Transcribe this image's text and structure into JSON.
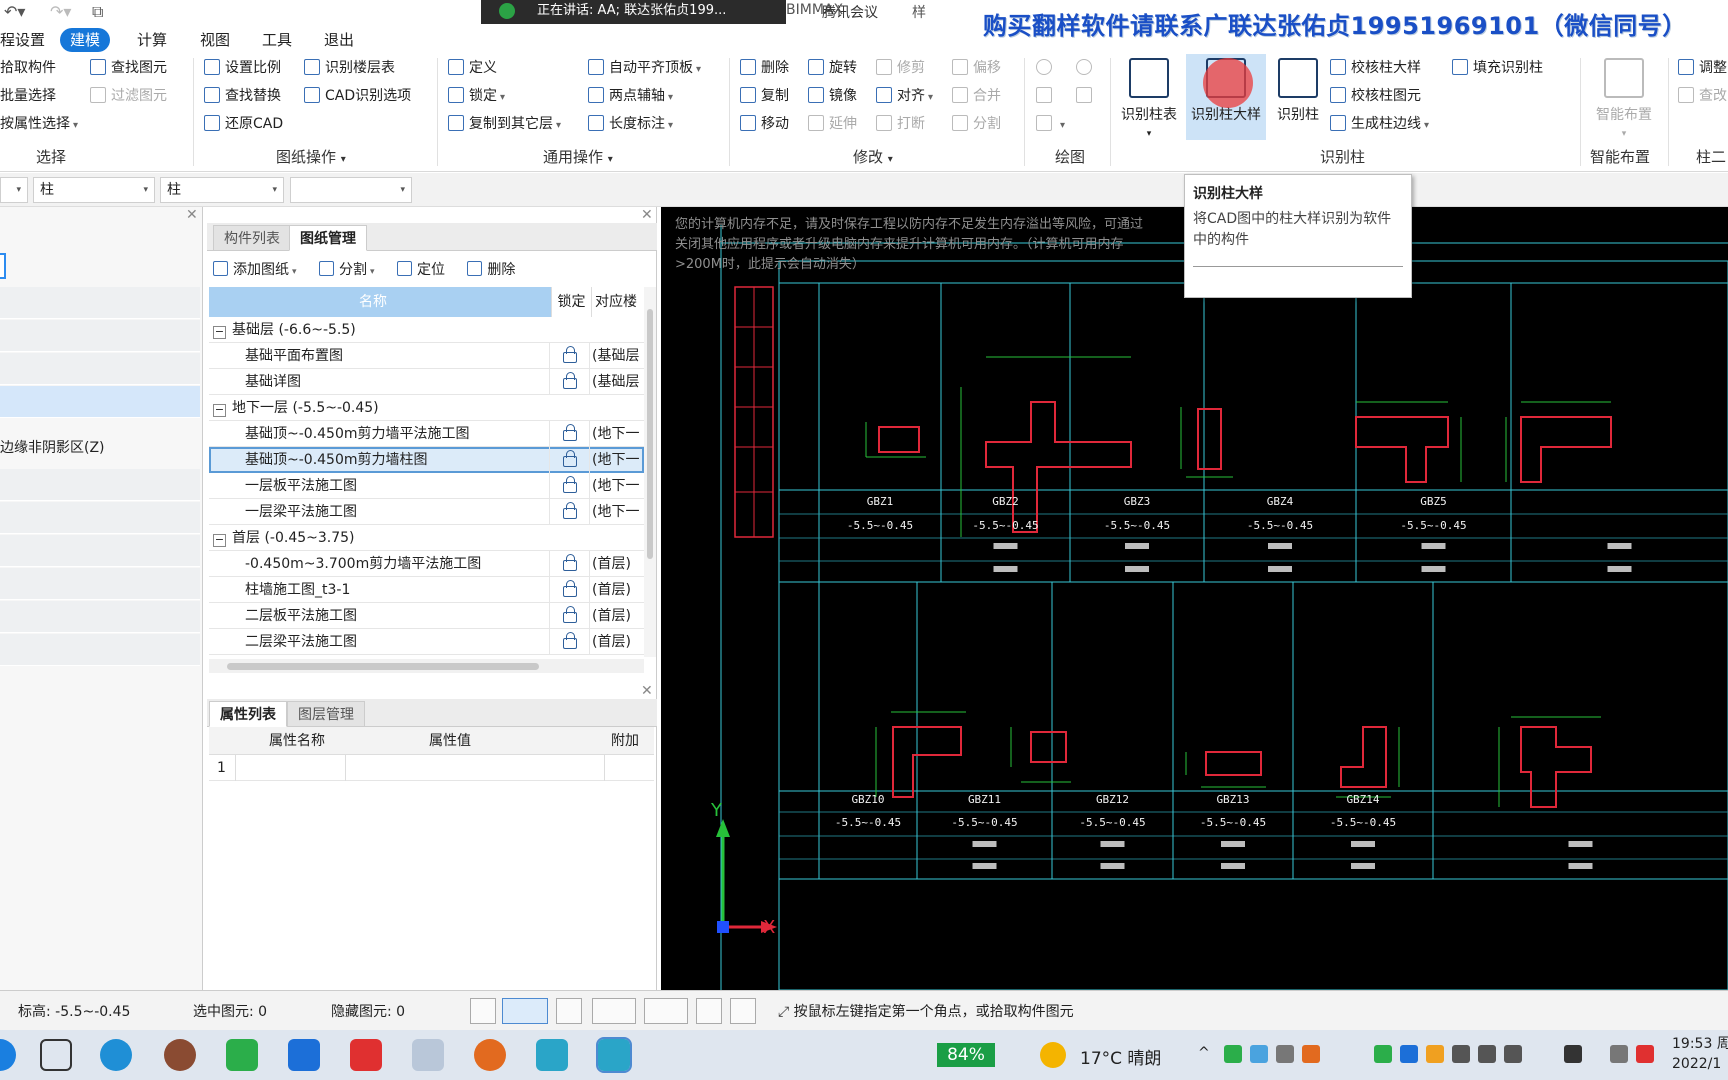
{
  "window": {
    "meeting_banner": "正在讲话: AA; 联达张佑贞199...",
    "meeting_app": "腾讯会议",
    "bimmax": "BIMMAX",
    "title_suffix": "样",
    "ad_text": "购买翻样软件请联系广联达张佑贞19951969101（微信同号）"
  },
  "menu": {
    "items": [
      "程设置",
      "建模",
      "计算",
      "视图",
      "工具",
      "退出"
    ],
    "active": "建模"
  },
  "ribbon": {
    "select_group": {
      "label": "选择",
      "buttons": [
        "拾取构件",
        "查找图元",
        "批量选择",
        "过滤图元",
        "按属性选择"
      ]
    },
    "drawing_ops": {
      "label": "图纸操作",
      "buttons": [
        "设置比例",
        "识别楼层表",
        "查找替换",
        "CAD识别选项",
        "还原CAD"
      ]
    },
    "general_ops": {
      "label": "通用操作",
      "buttons": [
        "定义",
        "自动平齐顶板",
        "锁定",
        "两点辅轴",
        "复制到其它层",
        "长度标注"
      ]
    },
    "modify": {
      "label": "修改",
      "buttons": [
        "删除",
        "旋转",
        "修剪",
        "偏移",
        "复制",
        "镜像",
        "对齐",
        "合并",
        "移动",
        "延伸",
        "打断",
        "分割"
      ]
    },
    "draw": {
      "label": "绘图"
    },
    "recognize_col": {
      "label": "识别柱",
      "big": [
        "识别柱表",
        "识别柱大样",
        "识别柱"
      ],
      "small": [
        "校核柱大样",
        "填充识别柱",
        "校核柱图元",
        "生成柱边线"
      ]
    },
    "smart": {
      "label": "智能布置",
      "big": "智能布置"
    },
    "col_2d": {
      "label": "柱二",
      "small": [
        "调整",
        "查改"
      ]
    }
  },
  "filters": {
    "selects": [
      "",
      "柱",
      "柱",
      ""
    ]
  },
  "left_panel": {
    "item_text": "边缘非阴影区(Z)"
  },
  "mid_panel": {
    "tabs": [
      "构件列表",
      "图纸管理"
    ],
    "active_tab": "图纸管理",
    "toolbar": [
      "添加图纸",
      "分割",
      "定位",
      "删除"
    ],
    "columns": [
      "名称",
      "锁定",
      "对应楼"
    ],
    "rows": [
      {
        "type": "group",
        "name": "基础层 (-6.6~-5.5)"
      },
      {
        "type": "item",
        "name": "基础平面布置图",
        "floor": "(基础层"
      },
      {
        "type": "item",
        "name": "基础详图",
        "floor": "(基础层"
      },
      {
        "type": "group",
        "name": "地下一层 (-5.5~-0.45)"
      },
      {
        "type": "item",
        "name": "基础顶~-0.450m剪力墙平法施工图",
        "floor": "(地下一"
      },
      {
        "type": "item",
        "name": "基础顶~-0.450m剪力墙柱图",
        "floor": "(地下一",
        "selected": true
      },
      {
        "type": "item",
        "name": "一层板平法施工图",
        "floor": "(地下一"
      },
      {
        "type": "item",
        "name": "一层梁平法施工图",
        "floor": "(地下一"
      },
      {
        "type": "group",
        "name": "首层 (-0.45~3.75)"
      },
      {
        "type": "item",
        "name": "-0.450m~3.700m剪力墙平法施工图",
        "floor": "(首层)"
      },
      {
        "type": "item",
        "name": "柱墙施工图_t3-1",
        "floor": "(首层)"
      },
      {
        "type": "item",
        "name": "二层板平法施工图",
        "floor": "(首层)"
      },
      {
        "type": "item",
        "name": "二层梁平法施工图",
        "floor": "(首层)"
      }
    ],
    "prop_tabs": [
      "属性列表",
      "图层管理"
    ],
    "prop_active": "属性列表",
    "prop_columns": [
      "属性名称",
      "属性值",
      "附加"
    ],
    "prop_row_num": "1"
  },
  "cad": {
    "memory_msg": "您的计算机内存不足，请及时保存工程以防内存不足发生内存溢出等风险，可通过关闭其他应用程序或者升级电脑内存来提升计算机可用内存。（计算机可用内存>200M时，此提示会自动消失）",
    "row1_labels": [
      "GBZ1",
      "GBZ2",
      "GBZ3",
      "GBZ4",
      "GBZ5"
    ],
    "row2_labels": [
      "GBZ10",
      "GBZ11",
      "GBZ12",
      "GBZ13",
      "GBZ14"
    ],
    "elev": "-5.5~-0.45",
    "axis_x": "X",
    "axis_y": "Y"
  },
  "tooltip": {
    "title": "识别柱大样",
    "desc": "将CAD图中的柱大样识别为软件中的构件"
  },
  "status": {
    "elev": "标高:   -5.5~-0.45",
    "selected": "选中图元: 0",
    "hidden": "隐藏图元: 0",
    "hint": "按鼠标左键指定第一个角点，或拾取构件图元"
  },
  "taskbar": {
    "battery": "84%",
    "weather": "17°C  晴朗",
    "time": "19:53 周",
    "date": "2022/1"
  },
  "colors": {
    "accent": "#1677d9",
    "ad": "#1a4fc6",
    "cad_bg": "#000000",
    "cad_red": "#e0283a",
    "cad_green": "#27c13a",
    "cad_cyan": "#39c7d6"
  }
}
